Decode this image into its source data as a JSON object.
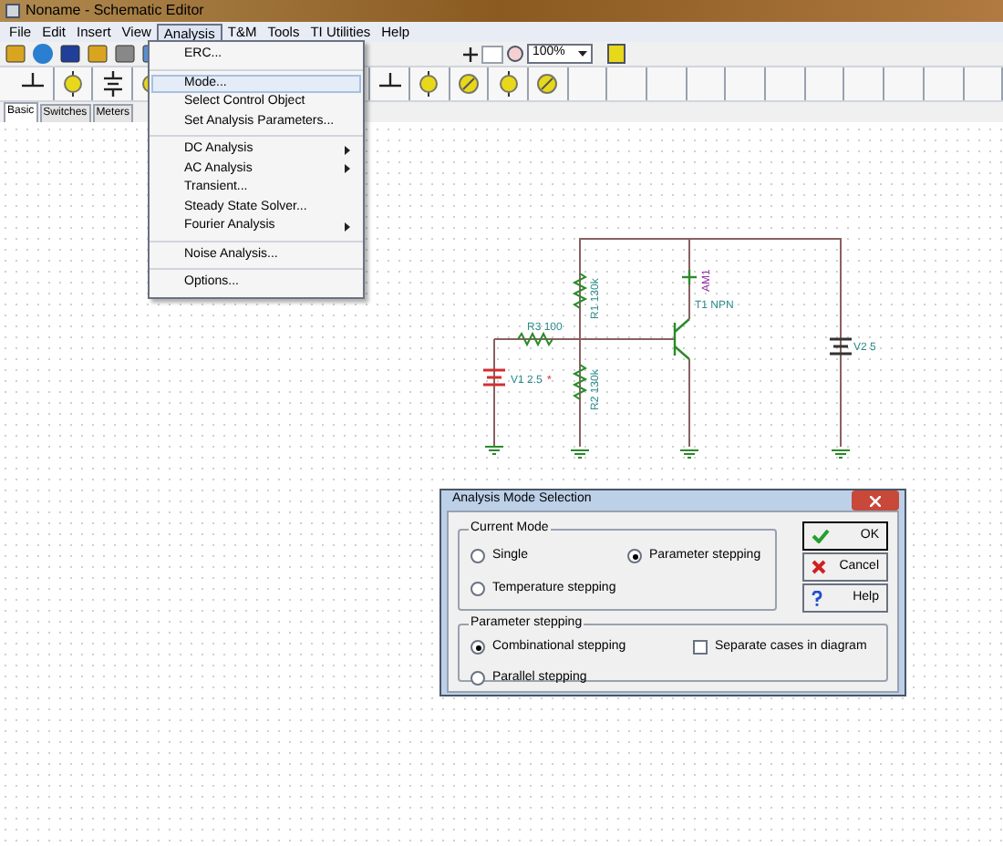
{
  "window": {
    "title": "Noname - Schematic Editor"
  },
  "menu": [
    {
      "label": "File",
      "selected": false
    },
    {
      "label": "Edit",
      "selected": false
    },
    {
      "label": "Insert",
      "selected": false
    },
    {
      "label": "View",
      "selected": false
    },
    {
      "label": "Analysis",
      "selected": true
    },
    {
      "label": "T&M",
      "selected": false
    },
    {
      "label": "Tools",
      "selected": false
    },
    {
      "label": "TI Utilities",
      "selected": false
    },
    {
      "label": "Help",
      "selected": false
    }
  ],
  "toolbar": {
    "zoom": "100%"
  },
  "component_tabs": [
    {
      "label": "Basic",
      "selected": true
    },
    {
      "label": "Switches",
      "selected": false
    },
    {
      "label": "Meters",
      "selected": false
    }
  ],
  "analysis_menu": [
    [
      {
        "label": "ERC...",
        "selected": false,
        "submenu": false
      }
    ],
    [
      {
        "label": "Mode...",
        "selected": true,
        "submenu": false
      },
      {
        "label": "Select Control Object",
        "selected": false,
        "submenu": false
      },
      {
        "label": "Set Analysis Parameters...",
        "selected": false,
        "submenu": false
      }
    ],
    [
      {
        "label": "DC Analysis",
        "selected": false,
        "submenu": true
      },
      {
        "label": "AC Analysis",
        "selected": false,
        "submenu": true
      },
      {
        "label": "Transient...",
        "selected": false,
        "submenu": false
      },
      {
        "label": "Steady State Solver...",
        "selected": false,
        "submenu": false
      },
      {
        "label": "Fourier Analysis",
        "selected": false,
        "submenu": true
      }
    ],
    [
      {
        "label": "Noise Analysis...",
        "selected": false,
        "submenu": false
      }
    ],
    [
      {
        "label": "Options...",
        "selected": false,
        "submenu": false
      }
    ]
  ],
  "circuit": {
    "r3": "R3 100",
    "v1": "V1 2.5",
    "v1_mark": "*",
    "r1": "R1 130k",
    "r2": "R2 130k",
    "t1": "T1 NPN",
    "am1": "AM1",
    "v2": "V2 5"
  },
  "dialog": {
    "title": "Analysis Mode Selection",
    "current_mode": {
      "label": "Current Mode",
      "options": [
        {
          "label": "Single",
          "selected": false
        },
        {
          "label": "Parameter stepping",
          "selected": true
        },
        {
          "label": "Temperature stepping",
          "selected": false
        }
      ]
    },
    "parameter_stepping": {
      "label": "Parameter stepping",
      "options": [
        {
          "label": "Combinational stepping",
          "selected": true
        },
        {
          "label": "Parallel stepping",
          "selected": false
        }
      ],
      "separate": {
        "label": "Separate cases in diagram",
        "checked": false
      }
    },
    "buttons": [
      {
        "kind": "ok",
        "label": "OK"
      },
      {
        "kind": "cancel",
        "label": "Cancel"
      },
      {
        "kind": "help",
        "label": "Help"
      }
    ]
  }
}
